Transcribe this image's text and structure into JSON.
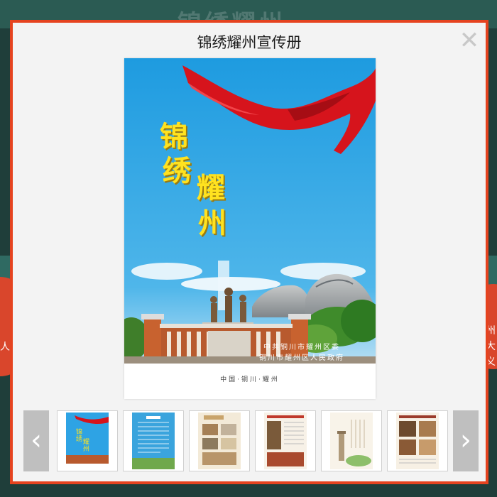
{
  "background": {
    "ghost_title": "锦绣耀州",
    "left_text": "人",
    "right_text": "州大义"
  },
  "modal": {
    "title": "锦绣耀州宣传册",
    "close_icon": "close-icon"
  },
  "cover": {
    "calligraphy": [
      "锦",
      "绣",
      "耀",
      "州"
    ],
    "org_line1": "中共铜川市耀州区委",
    "org_line2": "铜川市耀州区人民政府",
    "location": "中国·铜川·耀州"
  },
  "thumbnails": {
    "prev_icon": "chevron-left-icon",
    "next_icon": "chevron-right-icon",
    "prev_label": "‹",
    "next_label": "›",
    "items": [
      {
        "id": "cover",
        "selected": true
      },
      {
        "id": "page-2",
        "selected": false
      },
      {
        "id": "page-3",
        "selected": false
      },
      {
        "id": "page-4",
        "selected": false
      },
      {
        "id": "page-5",
        "selected": false
      },
      {
        "id": "page-6",
        "selected": false
      }
    ]
  },
  "colors": {
    "modal_border": "#e5431f",
    "sky": "#1e9be0",
    "calligraphy": "#ffe21f",
    "ribbon": "#d6141c"
  }
}
